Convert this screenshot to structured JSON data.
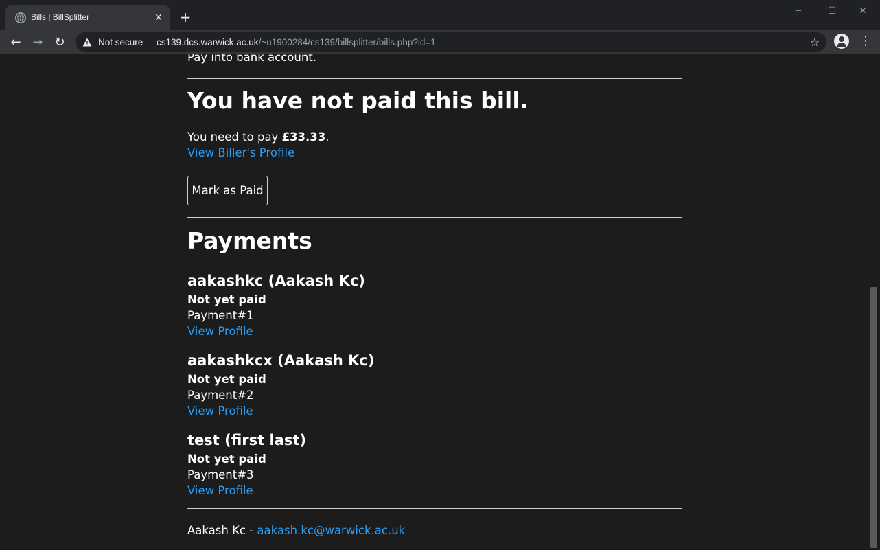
{
  "browser": {
    "tab_title": "Bills | BillSplitter",
    "security_label": "Not secure",
    "url_host": "cs139.dcs.warwick.ac.uk",
    "url_path": "/~u1900284/cs139/billsplitter/bills.php?id=1",
    "icons": [
      "globe-icon",
      "close-icon",
      "plus-icon",
      "back-icon",
      "forward-icon",
      "reload-icon",
      "warning-icon",
      "star-icon",
      "account-icon",
      "menu-icon"
    ]
  },
  "page": {
    "cut_text": "Pay into bank account.",
    "status_heading": "You have not paid this bill.",
    "need_pay_prefix": "You need to pay ",
    "need_pay_amount": "£33.33",
    "need_pay_suffix": ".",
    "biller_link": "View Biller's Profile",
    "mark_paid_button": "Mark as Paid",
    "payments_heading": "Payments",
    "payments": [
      {
        "name": "aakashkc (Aakash Kc)",
        "status": "Not yet paid",
        "reference": "Payment#1",
        "link": "View Profile"
      },
      {
        "name": "aakashkcx (Aakash Kc)",
        "status": "Not yet paid",
        "reference": "Payment#2",
        "link": "View Profile"
      },
      {
        "name": "test (first last)",
        "status": "Not yet paid",
        "reference": "Payment#3",
        "link": "View Profile"
      }
    ],
    "footer_name": "Aakash Kc - ",
    "footer_email": "aakash.kc@warwick.ac.uk"
  },
  "colors": {
    "background": "#1c1c1c",
    "link": "#2a9df4",
    "text": "#ffffff"
  }
}
